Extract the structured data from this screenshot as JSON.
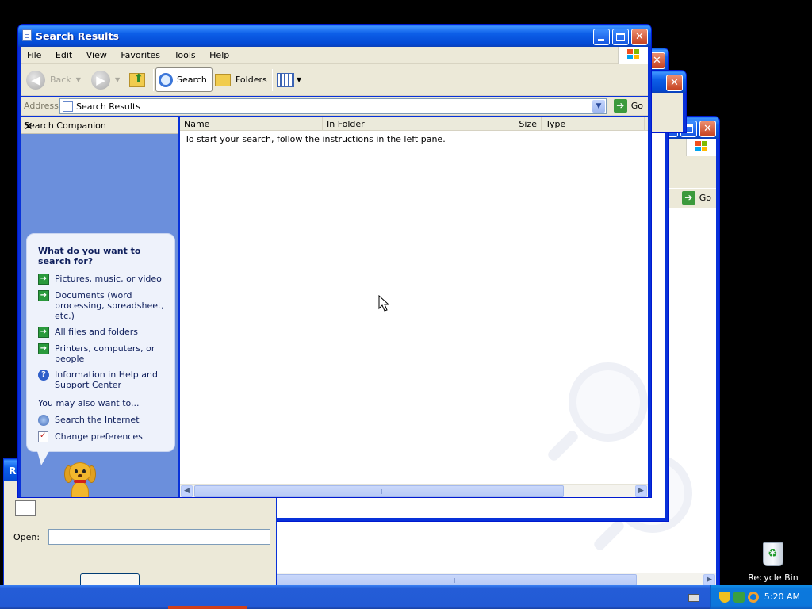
{
  "window": {
    "title": "Search Results",
    "menu": [
      "File",
      "Edit",
      "View",
      "Favorites",
      "Tools",
      "Help"
    ],
    "toolbar": {
      "back": "Back",
      "search": "Search",
      "folders": "Folders"
    },
    "address": {
      "label": "Address",
      "value": "Search Results",
      "go": "Go"
    }
  },
  "companion": {
    "header": "Search Companion",
    "question": "What do you want to search for?",
    "options": [
      {
        "label": "Pictures, music, or video",
        "icon": "green-arrow-icon"
      },
      {
        "label": "Documents (word processing, spreadsheet, etc.)",
        "icon": "green-arrow-icon"
      },
      {
        "label": "All files and folders",
        "icon": "green-arrow-icon"
      },
      {
        "label": "Printers, computers, or people",
        "icon": "green-arrow-icon"
      },
      {
        "label": "Information in Help and Support Center",
        "icon": "help-icon"
      }
    ],
    "also_heading": "You may also want to...",
    "also": [
      {
        "label": "Search the Internet",
        "icon": "internet-search-icon"
      },
      {
        "label": "Change preferences",
        "icon": "preferences-icon"
      }
    ]
  },
  "results": {
    "columns": [
      "Name",
      "In Folder",
      "Size",
      "Type"
    ],
    "message": "To start your search, follow the instructions in the left pane."
  },
  "background_windows": {
    "go_label": "Go",
    "run_dialog": {
      "title_fragment": "Ru",
      "open_label": "Open:"
    }
  },
  "desktop": {
    "recycle_bin": "Recycle Bin"
  },
  "taskbar": {
    "clock": "5:20 AM"
  },
  "colors": {
    "title_blue": "#0a5ce6",
    "companion_blue": "#6b8fdc",
    "taskbar_blue": "#245dd7",
    "close_red": "#c4401f"
  }
}
